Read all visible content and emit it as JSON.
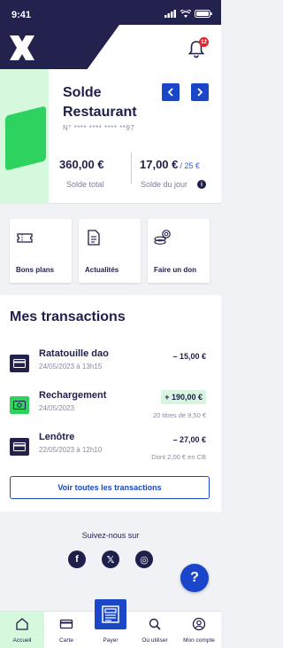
{
  "status_bar": {
    "time": "9:41"
  },
  "header": {
    "notification_count": "12"
  },
  "card": {
    "title": "Solde Restaurant",
    "number": "N° **** **** **** **97",
    "balance_total": "360,00 €",
    "balance_total_label": "Solde total",
    "balance_day": "17,00 €",
    "balance_day_max": "/ 25 €",
    "balance_day_label": "Solde du jour",
    "info_symbol": "i"
  },
  "actions": [
    {
      "label": "Bons plans",
      "icon": "ticket-icon"
    },
    {
      "label": "Actualités",
      "icon": "document-icon"
    },
    {
      "label": "Faire un don",
      "icon": "coins-icon"
    }
  ],
  "transactions": {
    "heading": "Mes transactions",
    "items": [
      {
        "name": "Ratatouille dao",
        "date": "24/05/2023 à 13h15",
        "amount": "– 15,00 €",
        "note": "",
        "type": "debit"
      },
      {
        "name": "Rechargement",
        "date": "24/05/2023",
        "amount": "+ 190,00 €",
        "note": "20 titres de 9,50 €",
        "type": "credit"
      },
      {
        "name": "Lenôtre",
        "date": "22/05/2023 à 12h10",
        "amount": "– 27,00 €",
        "note": "Dont 2,00 € en CB",
        "type": "debit"
      }
    ],
    "see_all": "Voir toutes les transactions"
  },
  "social": {
    "title": "Suivez-nous sur",
    "facebook": "f",
    "x": "𝕏",
    "instagram": "◎"
  },
  "help": {
    "symbol": "?"
  },
  "bottom_nav": [
    {
      "label": "Accueil",
      "icon": "home-icon",
      "active": true
    },
    {
      "label": "Carte",
      "icon": "card-icon",
      "active": false
    },
    {
      "label": "Payer",
      "icon": "qr-pay-icon",
      "active": false
    },
    {
      "label": "Où utiliser",
      "icon": "search-icon",
      "active": false
    },
    {
      "label": "Mon compte",
      "icon": "account-icon",
      "active": false
    }
  ],
  "colors": {
    "navy": "#23224f",
    "accent_blue": "#1a47c9",
    "green": "#2ed25e",
    "mint": "#d6f9dd"
  }
}
